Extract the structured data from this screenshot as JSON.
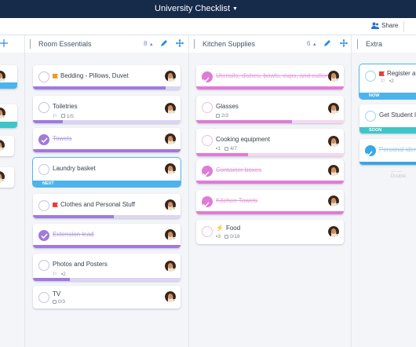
{
  "app": {
    "title": "University Checklist",
    "share_label": "Share"
  },
  "columns": {
    "room": {
      "name": "Room Essentials",
      "count": "8"
    },
    "kitchen": {
      "name": "Kitchen Supplies",
      "count": "6"
    },
    "extra": {
      "name": "Extra"
    }
  },
  "room_cards": [
    {
      "label": "Bedding - Pillows, Duvet",
      "flag": "orange",
      "progress": 0.9
    },
    {
      "label": "Toiletries",
      "meta_checklist": "1/5",
      "progress": 0.2
    },
    {
      "label": "Towels",
      "done": true
    },
    {
      "label": "Laundry basket",
      "banner": "NEXT"
    },
    {
      "label": "Clothes and Personal Stuff",
      "flag": "red",
      "progress": 0.55
    },
    {
      "label": "Extension lead",
      "done": true
    },
    {
      "label": "Photos and Posters",
      "meta_comments": "2",
      "progress": 0.25
    },
    {
      "label": "TV",
      "meta_checklist": "0/3"
    }
  ],
  "kitchen_cards": [
    {
      "label": "Utensils, dishes, bowls, cups, and cutlery",
      "done": true
    },
    {
      "label": "Glasses",
      "meta_checklist": "2/3",
      "progress": 0.65
    },
    {
      "label": "Cooking equipment",
      "meta_comments": "1",
      "meta_checklist": "4/7",
      "progress": 0.35
    },
    {
      "label": "Container boxes",
      "done": true
    },
    {
      "label": "Kitchen Towels",
      "done": true
    },
    {
      "label": "Food",
      "bolt": true,
      "meta_comments": "3",
      "meta_checklist": "0/18"
    }
  ],
  "extra_cards": [
    {
      "label": "Register at a",
      "flag": "red",
      "meta_comments": "2",
      "banner": "NOW"
    },
    {
      "label": "Get Student ID",
      "banner": "SOON"
    },
    {
      "label": "Personal identi",
      "done": true
    },
    {
      "label": "Double"
    }
  ],
  "colors": {
    "topbar": "#162a4a",
    "purple": "#a179e0",
    "pink": "#e07bd6",
    "blue": "#3aa7e6"
  }
}
